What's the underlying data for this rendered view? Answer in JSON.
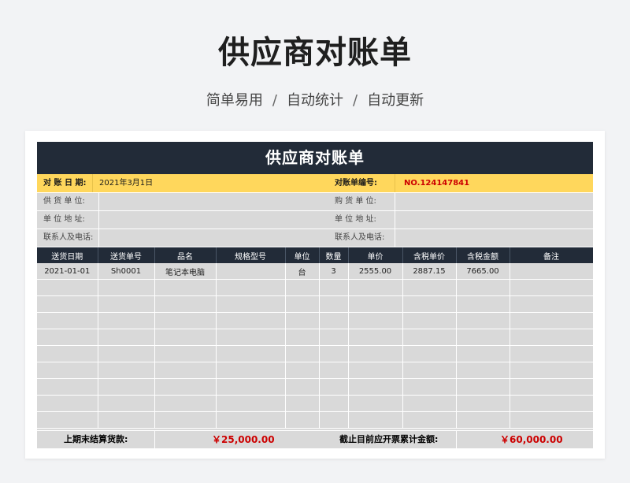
{
  "page": {
    "title": "供应商对账单",
    "subtitle": {
      "part1": "简单易用",
      "part2": "自动统计",
      "part3": "自动更新",
      "separator": "/"
    }
  },
  "sheet": {
    "title": "供应商对账单",
    "date_label": "对 账 日 期:",
    "date_value": "2021年3月1日",
    "number_label": "对账单编号:",
    "number_value": "NO.124147841",
    "supplier_label": "供 货 单 位:",
    "buyer_label": "购 货 单 位:",
    "supplier_address_label": "单 位 地 址:",
    "buyer_address_label": "单 位 地 址:",
    "supplier_contact_label": "联系人及电话:",
    "buyer_contact_label": "联系人及电话:",
    "columns": [
      "送货日期",
      "送货单号",
      "品名",
      "规格型号",
      "单位",
      "数量",
      "单价",
      "含税单价",
      "含税金额",
      "备注"
    ],
    "rows": [
      [
        "2021-01-01",
        "Sh0001",
        "笔记本电脑",
        "",
        "台",
        "3",
        "2555.00",
        "2887.15",
        "7665.00",
        ""
      ]
    ],
    "empty_row_count": 9,
    "footer": {
      "previous_label": "上期末结算货款:",
      "previous_value": "￥25,000.00",
      "invoice_label": "截止目前应开票累计金额:",
      "invoice_value": "￥60,000.00"
    }
  },
  "colors": {
    "header_dark": "#222b38",
    "highlight_yellow": "#ffd75c",
    "sheet_gray": "#d9d9d9",
    "accent_red": "#cc0000"
  }
}
